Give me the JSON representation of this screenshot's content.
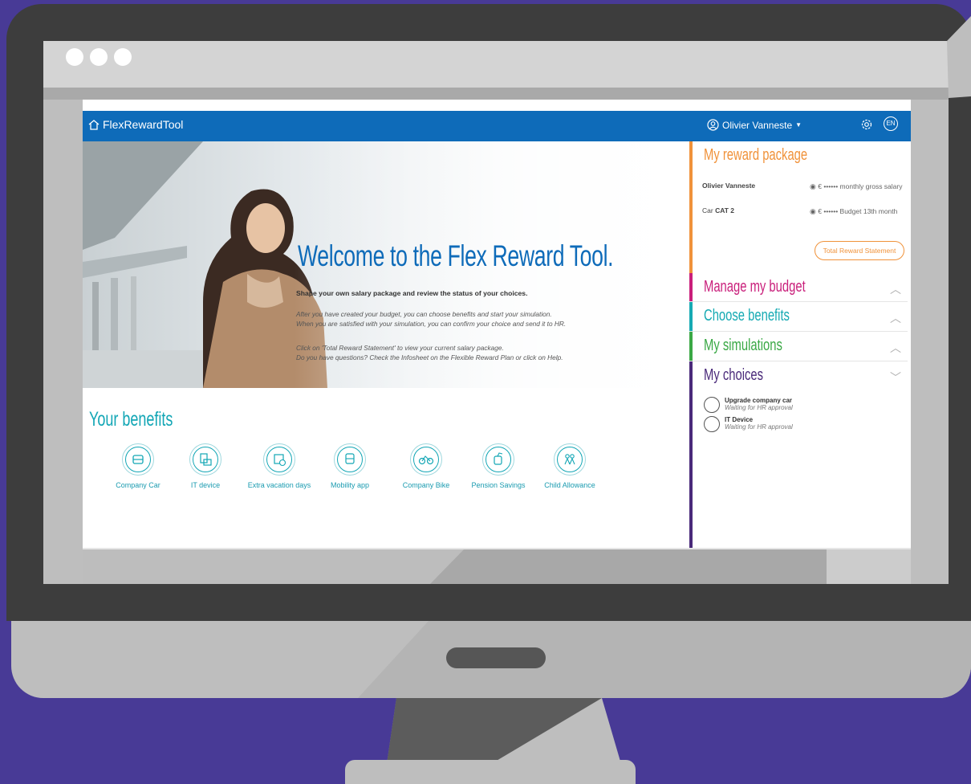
{
  "app": {
    "brand": "FlexRewardTool",
    "user_name": "Olivier Vanneste",
    "language": "EN"
  },
  "hero": {
    "title": "Welcome to the Flex Reward Tool.",
    "subtitle": "Shape your own salary package and review the status of your choices.",
    "paragraph1_line1": "After you have created your budget, you can choose benefits and start your simulation.",
    "paragraph1_line2": "When you are satisfied with your simulation, you can confirm your choice and send it to HR.",
    "paragraph2_line1": "Click on 'Total Reward Statement' to view your current salary package.",
    "paragraph2_line2": "Do you have questions? Check the Infosheet on the Flexible Reward Plan or click on Help."
  },
  "benefits": {
    "title": "Your benefits",
    "items": [
      {
        "label": "Company Car",
        "icon": "car-icon"
      },
      {
        "label": "IT device",
        "icon": "device-icon"
      },
      {
        "label": "Extra vacation days",
        "icon": "calendar-icon"
      },
      {
        "label": "Mobility app",
        "icon": "train-icon"
      },
      {
        "label": "Company Bike",
        "icon": "bike-icon"
      },
      {
        "label": "Pension Savings",
        "icon": "piggy-bank-icon"
      },
      {
        "label": "Child Allowance",
        "icon": "family-icon"
      }
    ]
  },
  "side": {
    "reward_title": "My reward package",
    "employee_name": "Olivier Vanneste",
    "car_label": "Car",
    "car_cat": "CAT 2",
    "salary_value": "€ •••••• monthly gross salary",
    "budget_value": "€ •••••• Budget 13th month",
    "trs_button": "Total Reward Statement",
    "sections": [
      {
        "title": "Manage my budget",
        "color": "#c91f7b"
      },
      {
        "title": "Choose benefits",
        "color": "#16aab3"
      },
      {
        "title": "My simulations",
        "color": "#3aa845"
      },
      {
        "title": "My choices",
        "color": "#4a2a7a"
      }
    ],
    "choices": [
      {
        "name": "Upgrade company car",
        "status": "Waiting for HR approval"
      },
      {
        "name": "IT Device",
        "status": "Waiting for HR approval"
      }
    ]
  },
  "colors": {
    "primary": "#0e6bb9",
    "teal": "#12a6b5",
    "orange": "#f0923a",
    "background": "#483a96"
  }
}
